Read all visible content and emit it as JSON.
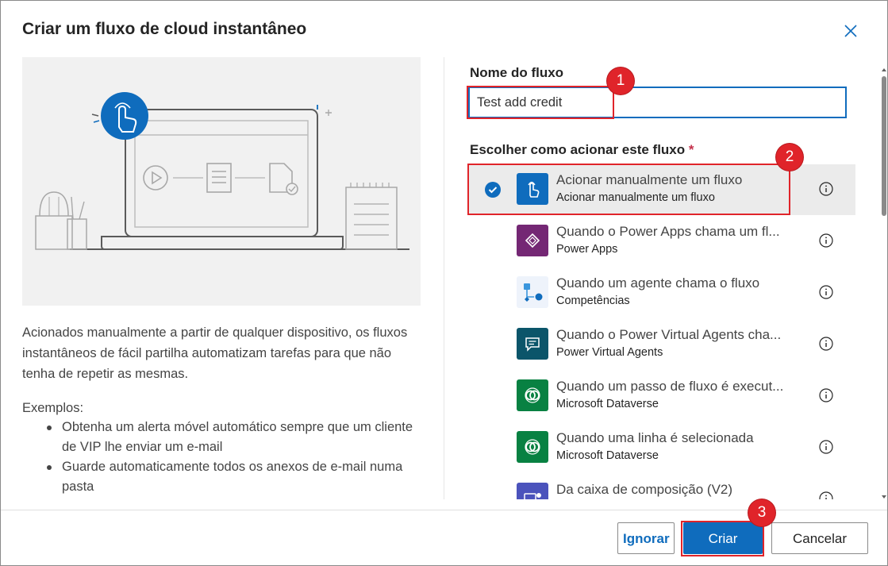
{
  "dialog": {
    "title": "Criar um fluxo de cloud instantâneo",
    "close_icon": "close-icon"
  },
  "left": {
    "description": "Acionados manualmente a partir de qualquer dispositivo, os fluxos instantâneos de fácil partilha automatizam tarefas para que não tenha de repetir as mesmas.",
    "examples_title": "Exemplos:",
    "examples": [
      "Obtenha um alerta móvel automático sempre que um cliente de VIP lhe enviar um e-mail",
      "Guarde automaticamente todos os anexos de e-mail numa pasta"
    ]
  },
  "form": {
    "name_label": "Nome do fluxo",
    "name_value": "Test add credit",
    "trigger_label": "Escolher como acionar este fluxo",
    "required_mark": "*"
  },
  "triggers": [
    {
      "title": "Acionar manualmente um fluxo",
      "subtitle": "Acionar manualmente um fluxo",
      "selected": true,
      "color": "#0f6cbd",
      "icon": "hand-tap-icon"
    },
    {
      "title": "Quando o Power Apps chama um fl...",
      "subtitle": "Power Apps",
      "selected": false,
      "color": "#742774",
      "icon": "power-apps-icon"
    },
    {
      "title": "Quando um agente chama o fluxo",
      "subtitle": "Competências",
      "selected": false,
      "color": "#eef3fb",
      "icon": "flow-nodes-icon"
    },
    {
      "title": "Quando o Power Virtual Agents cha...",
      "subtitle": "Power Virtual Agents",
      "selected": false,
      "color": "#0b556a",
      "icon": "chat-bot-icon"
    },
    {
      "title": "Quando um passo de fluxo é execut...",
      "subtitle": "Microsoft Dataverse",
      "selected": false,
      "color": "#088142",
      "icon": "dataverse-icon"
    },
    {
      "title": "Quando uma linha é selecionada",
      "subtitle": "Microsoft Dataverse",
      "selected": false,
      "color": "#088142",
      "icon": "dataverse-icon"
    },
    {
      "title": "Da caixa de composição (V2)",
      "subtitle": "",
      "selected": false,
      "color": "#4b53bc",
      "icon": "teams-icon"
    }
  ],
  "buttons": {
    "skip": "Ignorar",
    "create": "Criar",
    "cancel": "Cancelar"
  },
  "badges": [
    "1",
    "2",
    "3"
  ],
  "colors": {
    "accent": "#0f6cbd",
    "highlight": "#e0242a"
  }
}
